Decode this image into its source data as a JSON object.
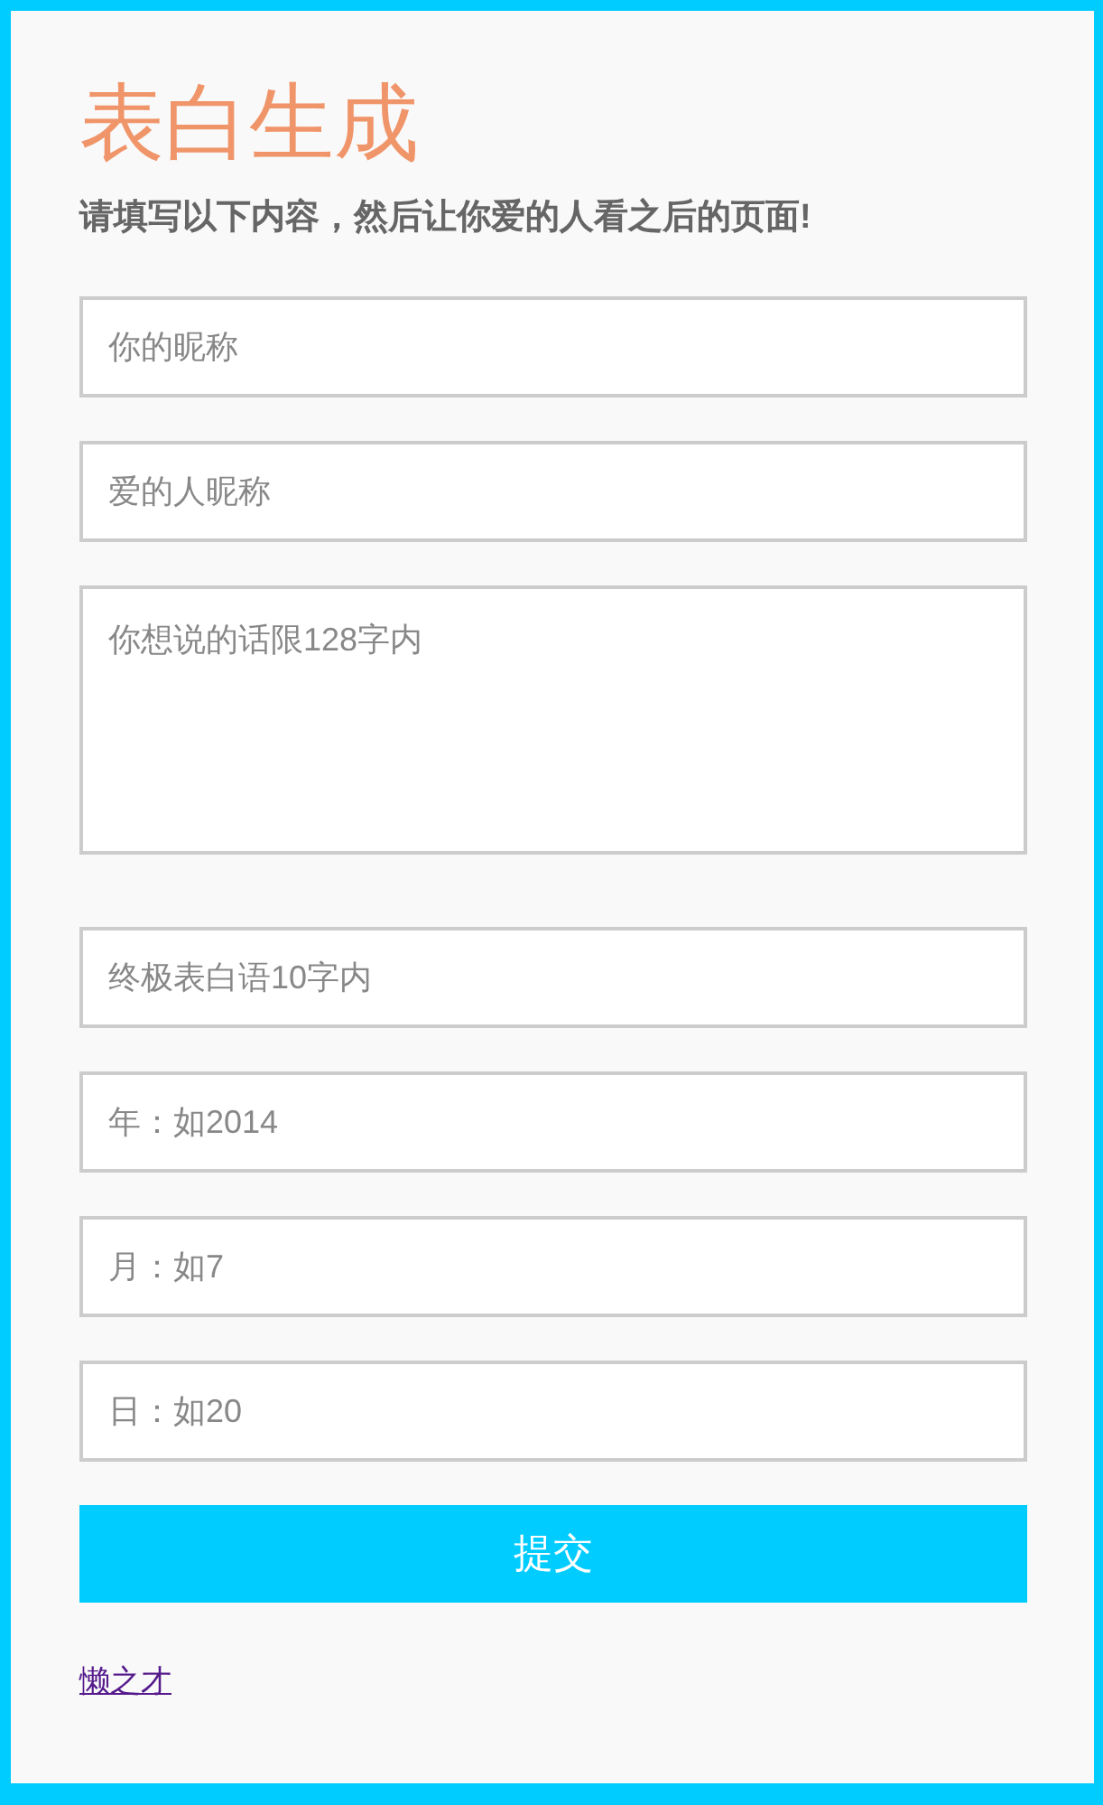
{
  "title": "表白生成",
  "subtitle": "请填写以下内容，然后让你爱的人看之后的页面!",
  "fields": [
    {
      "kind": "input",
      "placeholder": "你的昵称"
    },
    {
      "kind": "input",
      "placeholder": "爱的人昵称"
    },
    {
      "kind": "textarea",
      "placeholder": "你想说的话限128字内"
    },
    {
      "kind": "input",
      "placeholder": "终极表白语10字内"
    },
    {
      "kind": "input",
      "placeholder": "年：如2014"
    },
    {
      "kind": "input",
      "placeholder": "月：如7"
    },
    {
      "kind": "input",
      "placeholder": "日：如20"
    }
  ],
  "submit_button": "提交",
  "footer_link": "懒之才"
}
